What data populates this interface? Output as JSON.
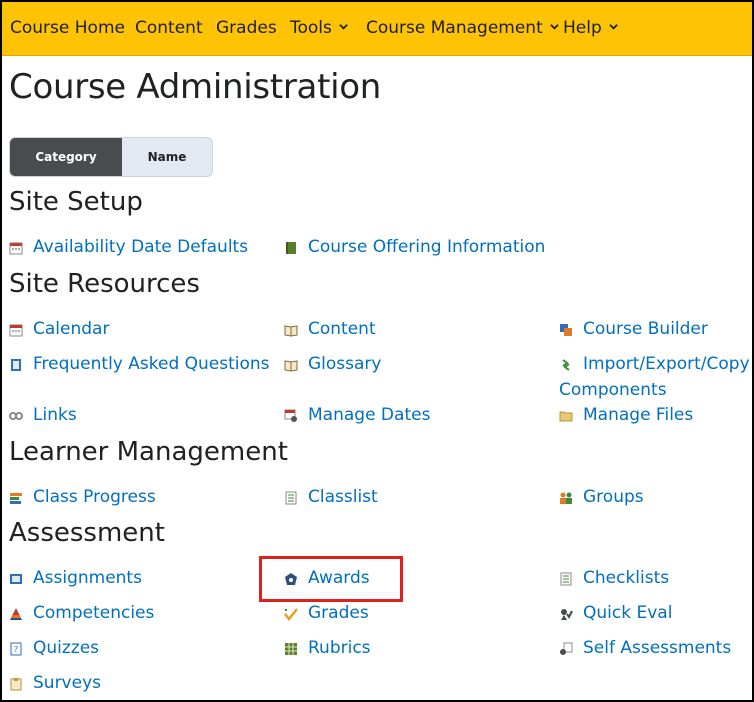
{
  "navbar": {
    "items": [
      {
        "label": "Course Home"
      },
      {
        "label": "Content"
      },
      {
        "label": "Grades"
      },
      {
        "label": "Tools"
      },
      {
        "label": "Course Management"
      },
      {
        "label": "Help"
      }
    ]
  },
  "page_title": "Course Administration",
  "view_toggle": {
    "active": "Category",
    "inactive": "Name"
  },
  "sections": [
    {
      "title": "Site Setup",
      "links": [
        "Availability Date Defaults",
        "Course Offering Information"
      ]
    },
    {
      "title": "Site Resources",
      "links": [
        "Calendar",
        "Content",
        "Course Builder",
        "Frequently Asked Questions",
        "Glossary",
        "Import/Export/Copy",
        "Components",
        "Links",
        "Manage Dates",
        "Manage Files"
      ]
    },
    {
      "title": "Learner Management",
      "links": [
        "Class Progress",
        "Classlist",
        "Groups"
      ]
    },
    {
      "title": "Assessment",
      "links": [
        "Assignments",
        "Awards",
        "Checklists",
        "Competencies",
        "Grades",
        "Quick Eval",
        "Quizzes",
        "Rubrics",
        "Self Assessments",
        "Surveys"
      ]
    }
  ],
  "colors": {
    "navbar": "#ffc305",
    "link": "#006fbf",
    "highlight": "#e0201b"
  }
}
